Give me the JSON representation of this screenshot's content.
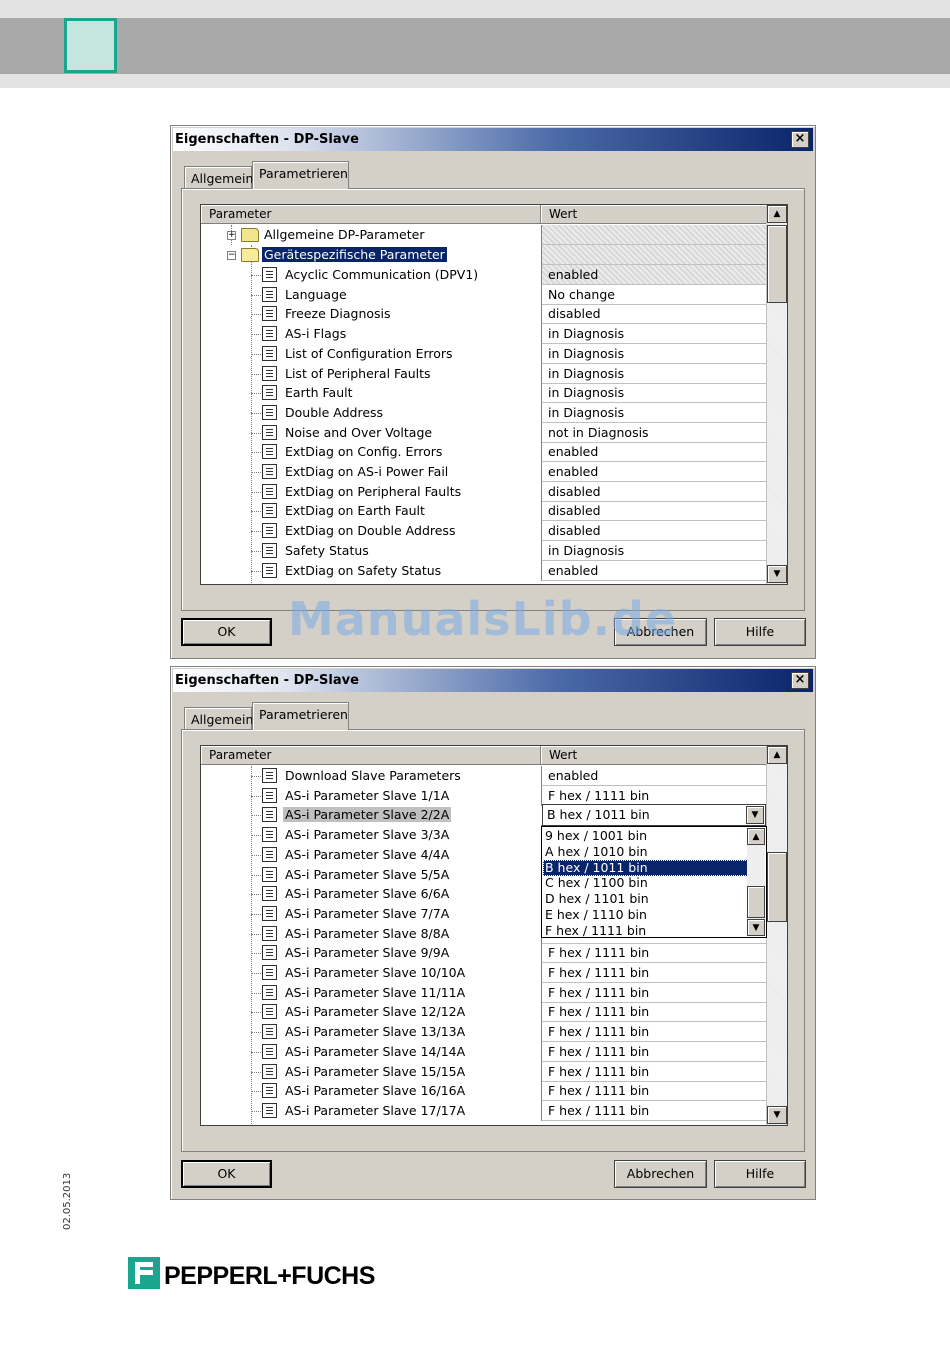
{
  "page": {
    "date": "02.05.2013",
    "logo_text": "PEPPERL+FUCHS",
    "watermark": "ManualsLib.de"
  },
  "dialog1": {
    "title": "Eigenschaften - DP-Slave",
    "close": "×",
    "tabs": [
      "Allgemein",
      "Parametrieren"
    ],
    "columns": [
      "Parameter",
      "Wert"
    ],
    "folders": [
      "Allgemeine DP-Parameter",
      "Gerätespezifische Parameter"
    ],
    "rows": [
      {
        "label": "Acyclic Communication (DPV1)",
        "value": "enabled"
      },
      {
        "label": "Language",
        "value": "No change"
      },
      {
        "label": "Freeze Diagnosis",
        "value": "disabled"
      },
      {
        "label": "AS-i Flags",
        "value": "in Diagnosis"
      },
      {
        "label": "List of Configuration Errors",
        "value": "in Diagnosis"
      },
      {
        "label": "List of Peripheral Faults",
        "value": "in Diagnosis"
      },
      {
        "label": "Earth Fault",
        "value": "in Diagnosis"
      },
      {
        "label": "Double Address",
        "value": "in Diagnosis"
      },
      {
        "label": "Noise and Over Voltage",
        "value": "not in Diagnosis"
      },
      {
        "label": "ExtDiag on Config. Errors",
        "value": "enabled"
      },
      {
        "label": "ExtDiag on AS-i Power Fail",
        "value": "enabled"
      },
      {
        "label": "ExtDiag on Peripheral Faults",
        "value": "disabled"
      },
      {
        "label": "ExtDiag on Earth Fault",
        "value": "disabled"
      },
      {
        "label": "ExtDiag on Double Address",
        "value": "disabled"
      },
      {
        "label": "Safety Status",
        "value": "in Diagnosis"
      },
      {
        "label": "ExtDiag on Safety Status",
        "value": "enabled"
      }
    ],
    "buttons": {
      "ok": "OK",
      "cancel": "Abbrechen",
      "help": "Hilfe"
    }
  },
  "dialog2": {
    "title": "Eigenschaften - DP-Slave",
    "close": "×",
    "tabs": [
      "Allgemein",
      "Parametrieren"
    ],
    "columns": [
      "Parameter",
      "Wert"
    ],
    "rows": [
      {
        "label": "Download Slave Parameters",
        "value": "enabled"
      },
      {
        "label": "AS-i Parameter Slave 1/1A",
        "value": "F hex / 1111 bin"
      },
      {
        "label": "AS-i Parameter Slave 2/2A",
        "value": "B hex / 1011 bin"
      },
      {
        "label": "AS-i Parameter Slave 3/3A",
        "value": ""
      },
      {
        "label": "AS-i Parameter Slave 4/4A",
        "value": ""
      },
      {
        "label": "AS-i Parameter Slave 5/5A",
        "value": ""
      },
      {
        "label": "AS-i Parameter Slave 6/6A",
        "value": ""
      },
      {
        "label": "AS-i Parameter Slave 7/7A",
        "value": ""
      },
      {
        "label": "AS-i Parameter Slave 8/8A",
        "value": ""
      },
      {
        "label": "AS-i Parameter Slave 9/9A",
        "value": "F hex / 1111 bin"
      },
      {
        "label": "AS-i Parameter Slave 10/10A",
        "value": "F hex / 1111 bin"
      },
      {
        "label": "AS-i Parameter Slave 11/11A",
        "value": "F hex / 1111 bin"
      },
      {
        "label": "AS-i Parameter Slave 12/12A",
        "value": "F hex / 1111 bin"
      },
      {
        "label": "AS-i Parameter Slave 13/13A",
        "value": "F hex / 1111 bin"
      },
      {
        "label": "AS-i Parameter Slave 14/14A",
        "value": "F hex / 1111 bin"
      },
      {
        "label": "AS-i Parameter Slave 15/15A",
        "value": "F hex / 1111 bin"
      },
      {
        "label": "AS-i Parameter Slave 16/16A",
        "value": "F hex / 1111 bin"
      },
      {
        "label": "AS-i Parameter Slave 17/17A",
        "value": "F hex / 1111 bin"
      }
    ],
    "dropdown_options": [
      "9 hex / 1001 bin",
      "A hex / 1010 bin",
      "B hex / 1011 bin",
      "C hex / 1100 bin",
      "D hex / 1101 bin",
      "E hex / 1110 bin",
      "F hex / 1111 bin"
    ],
    "dropdown_selected": "B hex / 1011 bin",
    "buttons": {
      "ok": "OK",
      "cancel": "Abbrechen",
      "help": "Hilfe"
    }
  }
}
